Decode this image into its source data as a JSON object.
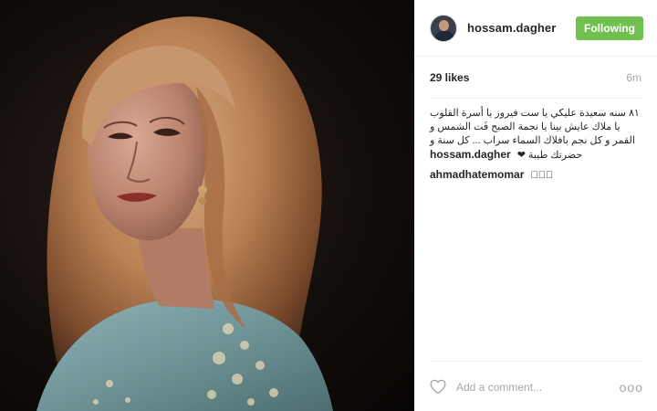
{
  "post": {
    "username": "hossam.dagher",
    "follow_label": "Following",
    "likes": "29 likes",
    "time": "6m",
    "comment_placeholder": "Add a comment...",
    "more_label": "ooo"
  },
  "comments": [
    {
      "user": "hossam.dagher",
      "text": "٨١ سنه سعيدة عليكي يا ست فيروز يا أسرة القلوب يا ملاك عايش بينا يا نجمة الصبح فَت الشمس و القمر و كل نجم بافلاك السماء سراب ... كل سنة و حضرتك طيبة ❤"
    },
    {
      "user": "ahmadhatemomar",
      "text": "󾟛󾟛󾟛"
    }
  ],
  "colors": {
    "follow_button": "#70c050",
    "muted_text": "#a5a7aa",
    "text": "#262626"
  },
  "icons": {
    "like": "heart-icon",
    "more": "more-options-icon"
  }
}
